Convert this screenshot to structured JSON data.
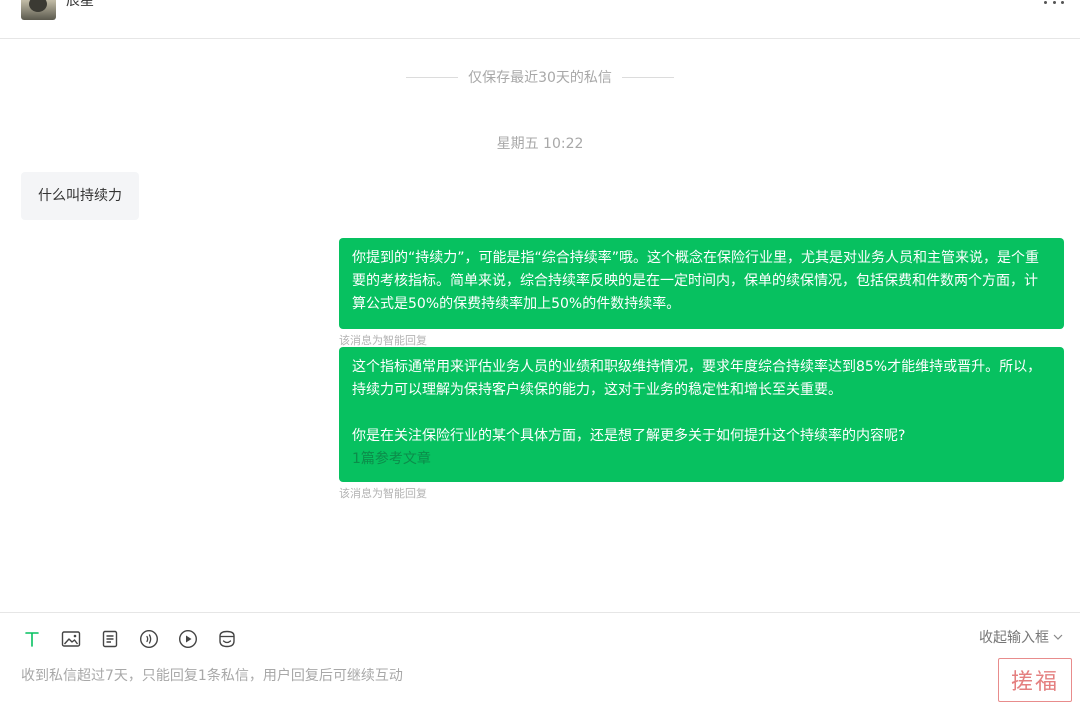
{
  "header": {
    "contact_name": "辰星",
    "more_icon": "more-dots-icon"
  },
  "notice": "仅保存最近30天的私信",
  "timestamp": "星期五 10:22",
  "messages": {
    "incoming": "什么叫持续力",
    "reply_1": "你提到的“持续力”，可能是指“综合持续率”哦。这个概念在保险行业里，尤其是对业务人员和主管来说，是个重要的考核指标。简单来说，综合持续率反映的是在一定时间内，保单的续保情况，包括保费和件数两个方面，计算公式是50%的保费持续率加上50%的件数持续率。",
    "reply_1_tag": "该消息为智能回复",
    "reply_2_para1": "这个指标通常用来评估业务人员的业绩和职级维持情况，要求年度综合持续率达到85%才能维持或晋升。所以，持续力可以理解为保持客户续保的能力，这对于业务的稳定性和增长至关重要。",
    "reply_2_para2": "你是在关注保险行业的某个具体方面，还是想了解更多关于如何提升这个持续率的内容呢?",
    "reply_2_link": "1篇参考文章",
    "reply_2_tag": "该消息为智能回复"
  },
  "toolbar": {
    "icons": [
      "text-format-icon",
      "image-icon",
      "document-icon",
      "voice-icon",
      "video-icon",
      "emoji-icon"
    ],
    "active_color": "#07c160",
    "collapse_label": "收起输入框"
  },
  "composer": {
    "placeholder": "收到私信超过7天，只能回复1条私信，用户回复后可继续互动"
  },
  "watermark": "搓福",
  "colors": {
    "reply_bubble": "#07c160",
    "incoming_bubble": "#f4f5f7"
  }
}
